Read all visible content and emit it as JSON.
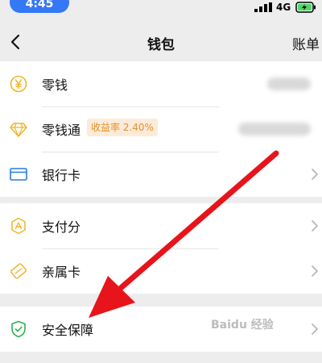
{
  "status": {
    "time": "4:45",
    "network": "4G"
  },
  "nav": {
    "title": "钱包",
    "right": "账单"
  },
  "wallet_items": [
    {
      "label": "零钱"
    },
    {
      "label": "零钱通",
      "badge": "收益率 2.40%"
    },
    {
      "label": "银行卡"
    },
    {
      "label": "支付分"
    },
    {
      "label": "亲属卡"
    },
    {
      "label": "安全保障"
    }
  ],
  "icons": {
    "coin": "yen-coin-icon",
    "diamond": "diamond-icon",
    "card": "bank-card-icon",
    "score": "payment-score-icon",
    "family": "family-card-icon",
    "shield": "shield-check-icon"
  },
  "colors": {
    "accent": "#f0b429",
    "security": "#2eb34a",
    "arrow": "#e8141b",
    "badge_bg": "#fdebd9",
    "badge_text": "#e5912f"
  },
  "watermark": "Baidu 经验"
}
